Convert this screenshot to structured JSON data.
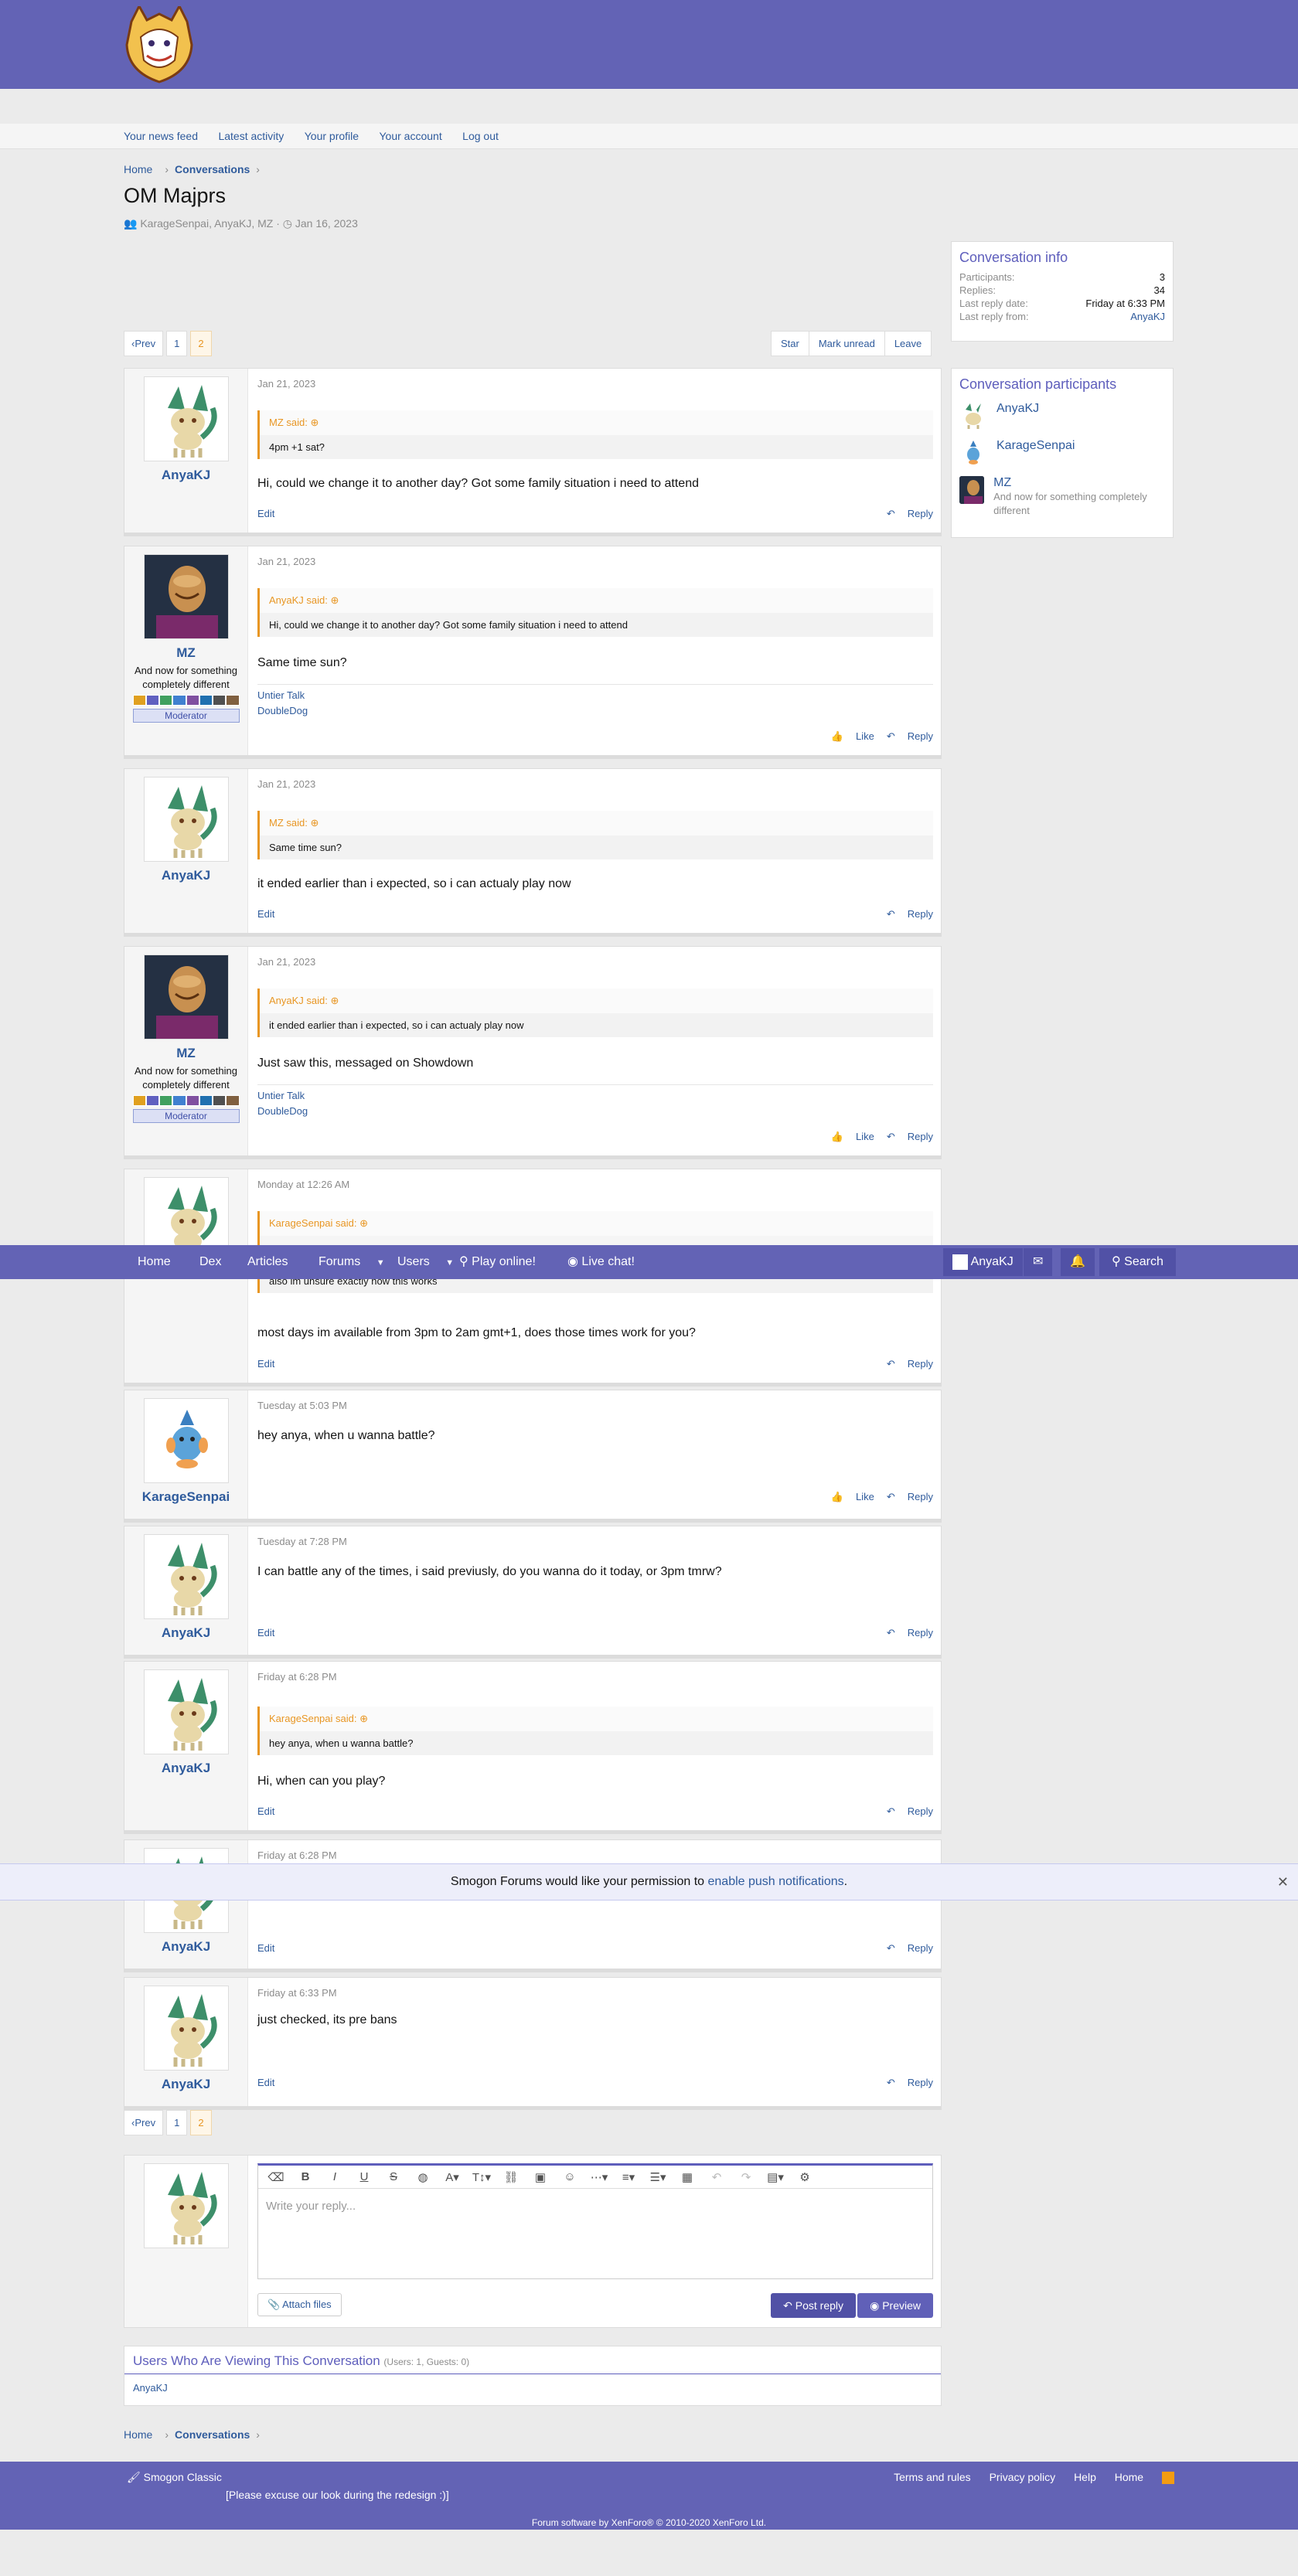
{
  "subnav": [
    "Your news feed",
    "Latest activity",
    "Your profile",
    "Your account",
    "Log out"
  ],
  "breadcrumb": {
    "home": "Home",
    "current": "Conversations"
  },
  "conversation": {
    "title": "OM Majprs",
    "participants_line": "KarageSenpai, AnyaKJ, MZ",
    "date": "Jan 16, 2023"
  },
  "pager": {
    "prev": "Prev",
    "pages": [
      "1",
      "2"
    ],
    "current": "2"
  },
  "conv_actions": [
    "Star",
    "Mark unread",
    "Leave"
  ],
  "info": {
    "heading": "Conversation info",
    "rows": [
      {
        "label": "Participants:",
        "value": "3"
      },
      {
        "label": "Replies:",
        "value": "34"
      },
      {
        "label": "Last reply date:",
        "value": "Friday at 6:33 PM"
      },
      {
        "label": "Last reply from:",
        "value": "AnyaKJ"
      }
    ]
  },
  "participants": {
    "heading": "Conversation participants",
    "list": [
      {
        "name": "AnyaKJ",
        "title": ""
      },
      {
        "name": "KarageSenpai",
        "title": ""
      },
      {
        "name": "MZ",
        "title": "And now for something completely different"
      }
    ]
  },
  "messages": [
    {
      "user": "AnyaKJ",
      "date": "Jan 21, 2023",
      "quote_author": "MZ said:",
      "quote_text": "4pm +1 sat?",
      "text": "Hi, could we change it to another day? Got some family situation i need to attend",
      "edit": "Edit",
      "actions": [
        "Reply"
      ]
    },
    {
      "user": "MZ",
      "user_title": "And now for something completely different",
      "badge": "Moderator",
      "date": "Jan 21, 2023",
      "quote_author": "AnyaKJ said:",
      "quote_text": "Hi, could we change it to another day? Got some family situation i need to attend",
      "text": "Same time sun?",
      "sig": [
        "Untier Talk",
        "DoubleDog"
      ],
      "actions": [
        "Like",
        "Reply"
      ]
    },
    {
      "user": "AnyaKJ",
      "date": "Jan 21, 2023",
      "quote_author": "MZ said:",
      "quote_text": "Same time sun?",
      "text": "it ended earlier than i expected, so i can actualy play now",
      "edit": "Edit",
      "actions": [
        "Reply"
      ]
    },
    {
      "user": "MZ",
      "user_title": "And now for something completely different",
      "badge": "Moderator",
      "date": "Jan 21, 2023",
      "quote_author": "AnyaKJ said:",
      "quote_text": "it ended earlier than i expected, so i can actualy play now",
      "text": "Just saw this, messaged on Showdown",
      "sig": [
        "Untier Talk",
        "DoubleDog"
      ],
      "actions": [
        "Like",
        "Reply"
      ]
    },
    {
      "user": "AnyaKJ",
      "date": "Monday at 12:26 AM",
      "quote_author": "KarageSenpai said:",
      "quote_text": "also im unsure exactly how this works",
      "text": "most days im available from 3pm to 2am gmt+1, does those times work for you?",
      "edit": "Edit",
      "actions": [
        "Reply"
      ]
    },
    {
      "user": "KarageSenpai",
      "date": "Tuesday at 5:03 PM",
      "text": "hey anya, when u wanna battle?",
      "actions": [
        "Like",
        "Reply"
      ]
    },
    {
      "user": "AnyaKJ",
      "date": "Tuesday at 7:28 PM",
      "text": "I can battle any of the times, i said previusly, do you wanna do it today, or 3pm tmrw?",
      "edit": "Edit",
      "actions": [
        "Reply"
      ]
    },
    {
      "user": "AnyaKJ",
      "date": "Friday at 6:28 PM",
      "quote_author": "KarageSenpai said:",
      "quote_text": "hey anya, when u wanna battle?",
      "text": "Hi, when can you play?",
      "edit": "Edit",
      "actions": [
        "Reply"
      ]
    },
    {
      "user": "AnyaKJ",
      "date": "Friday at 6:28 PM",
      "edit": "Edit",
      "actions": [
        "Reply"
      ]
    },
    {
      "user": "AnyaKJ",
      "date": "Friday at 6:33 PM",
      "text": "just checked, its pre bans",
      "edit": "Edit",
      "actions": [
        "Reply"
      ]
    }
  ],
  "navbar": {
    "items": [
      "Home",
      "Dex",
      "Articles",
      "Forums",
      "Users",
      "Play online!",
      "Live chat!"
    ],
    "username": "AnyaKJ",
    "search": "Search"
  },
  "push": {
    "text": "Smogon Forums would like your permission to ",
    "link": "enable push notifications",
    "end": "."
  },
  "reply": {
    "placeholder": "Write your reply...",
    "attach": "Attach files",
    "post": "Post reply",
    "preview": "Preview"
  },
  "viewing": {
    "heading": "Users Who Are Viewing This Conversation",
    "counts": "(Users: 1, Guests: 0)",
    "users": "AnyaKJ"
  },
  "footer": {
    "style": "Smogon Classic",
    "note": "[Please excuse our look during the redesign :)]",
    "links": [
      "Terms and rules",
      "Privacy policy",
      "Help",
      "Home"
    ],
    "copyright": "Forum software by XenForo® © 2010-2020 XenForo Ltd."
  },
  "colors": {
    "brand": "#6363b5",
    "link": "#2f5b9c",
    "quote": "#e89623"
  }
}
